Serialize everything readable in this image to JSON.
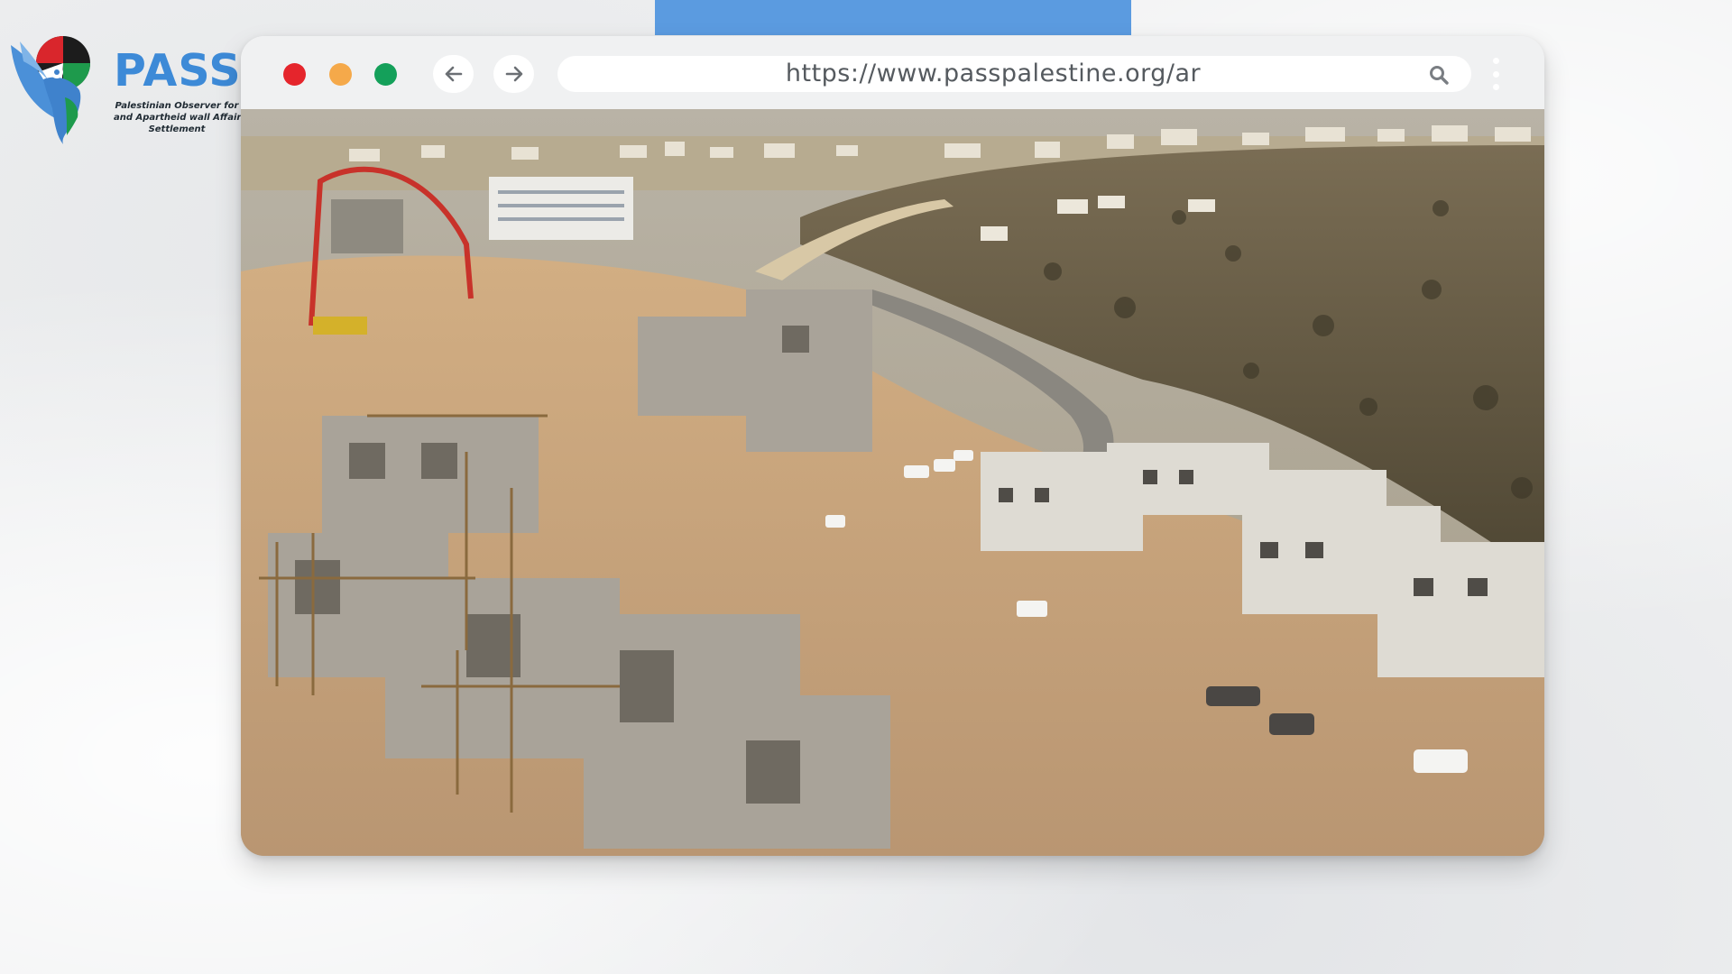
{
  "logo": {
    "name": "PASS",
    "subtitle_lines": [
      "Palestinian Observer for",
      "and Apartheid wall Affairs",
      "Settlement"
    ]
  },
  "browser": {
    "url": "https://www.passpalestine.org/ar",
    "window_controls": [
      "close",
      "minimize",
      "maximize"
    ],
    "nav": {
      "back_icon": "arrow-left-icon",
      "forward_icon": "arrow-right-icon"
    },
    "search_icon": "search-icon",
    "menu_icon": "kebab-menu-icon"
  },
  "colors": {
    "accent_blue": "#5b9be0",
    "logo_blue": "#3d8ad7",
    "close": "#e5252c",
    "minimize": "#f5a94a",
    "maximize": "#14a05a"
  }
}
